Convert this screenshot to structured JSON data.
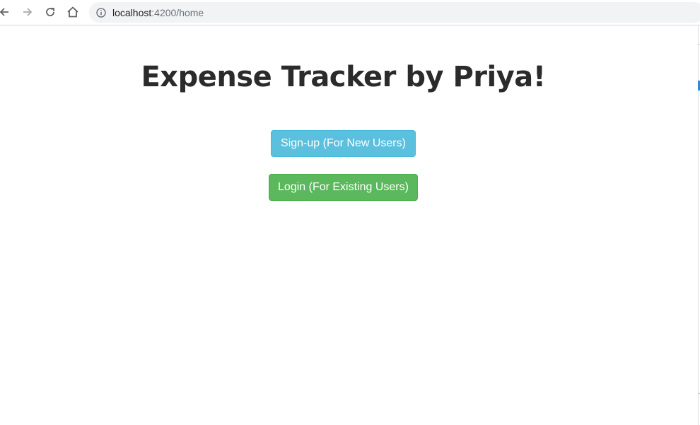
{
  "browser": {
    "url_host": "localhost",
    "url_rest": ":4200/home",
    "icons": {
      "back": "arrow-left-icon",
      "forward": "arrow-right-icon",
      "reload": "reload-icon",
      "home": "home-icon",
      "info": "info-icon"
    }
  },
  "page": {
    "title": "Expense Tracker by Priya!",
    "signup_label": "Sign-up (For New Users)",
    "login_label": "Login (For Existing Users)"
  },
  "colors": {
    "title": "#2b2b2b",
    "signup_button": "#5bc0de",
    "login_button": "#5cb85c",
    "address_bar": "#f1f3f4"
  }
}
